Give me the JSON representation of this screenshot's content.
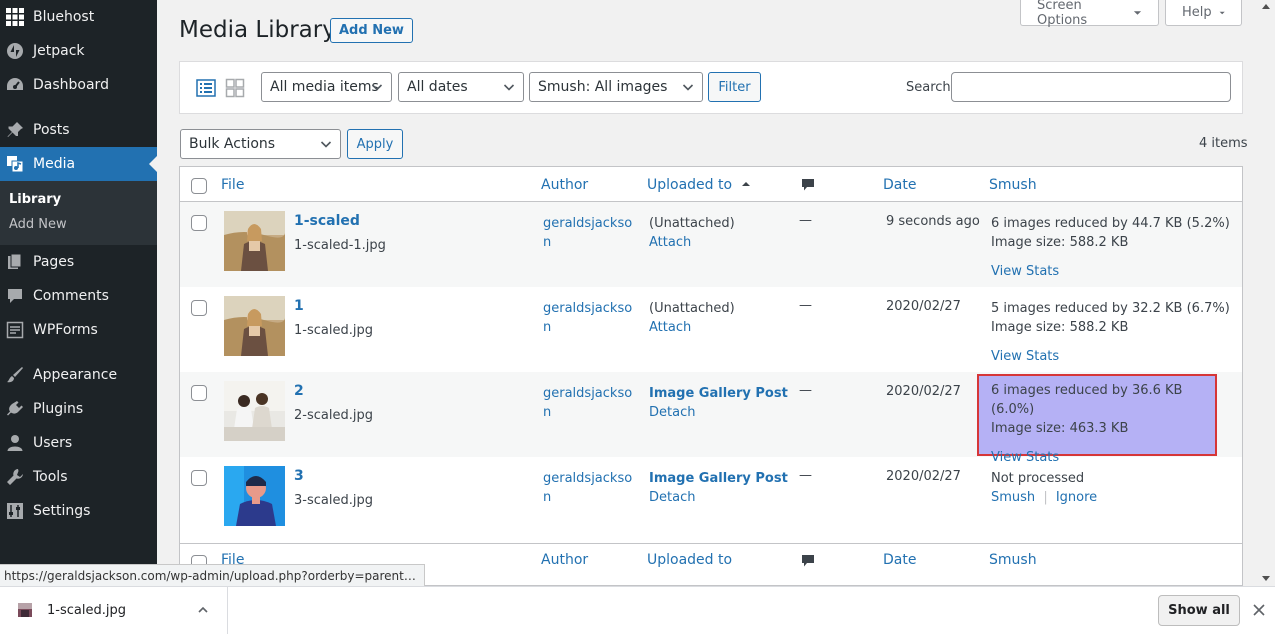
{
  "sidebar": {
    "items": [
      {
        "label": "Bluehost",
        "icon": "grid-icon"
      },
      {
        "label": "Jetpack",
        "icon": "jetpack-icon"
      },
      {
        "label": "Dashboard",
        "icon": "dashboard-icon"
      },
      {
        "label": "Posts",
        "icon": "pin-icon"
      },
      {
        "label": "Media",
        "icon": "media-icon"
      },
      {
        "label": "Pages",
        "icon": "pages-icon"
      },
      {
        "label": "Comments",
        "icon": "comments-icon"
      },
      {
        "label": "WPForms",
        "icon": "forms-icon"
      },
      {
        "label": "Appearance",
        "icon": "brush-icon"
      },
      {
        "label": "Plugins",
        "icon": "plugin-icon"
      },
      {
        "label": "Users",
        "icon": "users-icon"
      },
      {
        "label": "Tools",
        "icon": "wrench-icon"
      },
      {
        "label": "Settings",
        "icon": "settings-icon"
      }
    ],
    "submenu": [
      "Library",
      "Add New"
    ]
  },
  "header": {
    "title": "Media Library",
    "add_new": "Add New",
    "screen_options": "Screen Options",
    "help": "Help"
  },
  "filters": {
    "media_type": "All media items",
    "dates": "All dates",
    "smush": "Smush: All images",
    "filter_button": "Filter",
    "search_label": "Search",
    "search_value": ""
  },
  "bulk": {
    "select": "Bulk Actions",
    "apply": "Apply",
    "items_count": "4 items"
  },
  "table": {
    "columns": {
      "file": "File",
      "author": "Author",
      "uploaded_to": "Uploaded to",
      "date": "Date",
      "smush": "Smush"
    },
    "rows": [
      {
        "title": "1-scaled",
        "filename": "1-scaled-1.jpg",
        "author": "geraldsjackson",
        "uploaded_main": "(Unattached)",
        "uploaded_action": "Attach",
        "comments": "—",
        "date": "9 seconds ago",
        "smush_line1": "6 images reduced by 44.7 KB (5.2%)",
        "smush_line2": "Image size: 588.2 KB",
        "smush_action": "View Stats"
      },
      {
        "title": "1",
        "filename": "1-scaled.jpg",
        "author": "geraldsjackson",
        "uploaded_main": "(Unattached)",
        "uploaded_action": "Attach",
        "comments": "—",
        "date": "2020/02/27",
        "smush_line1": "5 images reduced by 32.2 KB (6.7%)",
        "smush_line2": "Image size: 588.2 KB",
        "smush_action": "View Stats"
      },
      {
        "title": "2",
        "filename": "2-scaled.jpg",
        "author": "geraldsjackson",
        "uploaded_main": "Image Gallery Post",
        "uploaded_action": "Detach",
        "comments": "—",
        "date": "2020/02/27",
        "smush_line1": "6 images reduced by 36.6 KB (6.0%)",
        "smush_line2": "Image size: 463.3 KB",
        "smush_action": "View Stats"
      },
      {
        "title": "3",
        "filename": "3-scaled.jpg",
        "author": "geraldsjackson",
        "uploaded_main": "Image Gallery Post",
        "uploaded_action": "Detach",
        "comments": "—",
        "date": "2020/02/27",
        "smush_line1": "Not processed",
        "smush_action_1": "Smush",
        "smush_action_2": "Ignore"
      }
    ]
  },
  "status_url": "https://geraldsjackson.com/wp-admin/upload.php?orderby=parent…",
  "download_bar": {
    "file_name": "1-scaled.jpg",
    "show_all": "Show all"
  },
  "colors": {
    "sidebar_bg": "#1d2327",
    "accent": "#2271b1",
    "highlight_fill": "#b5b1f5",
    "highlight_border": "#d63638"
  }
}
